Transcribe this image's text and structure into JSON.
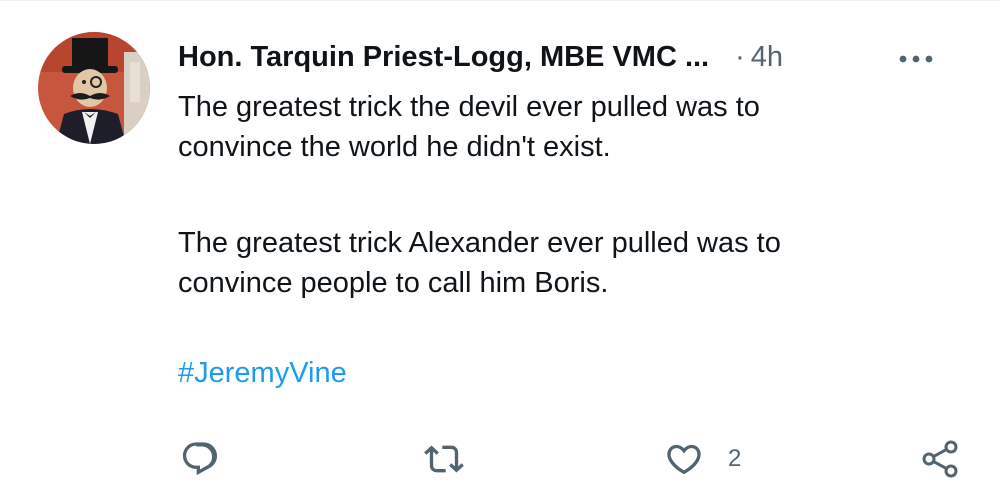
{
  "tweet": {
    "author_name": "Hon. Tarquin Priest-Logg, MBE VMC ...",
    "separator": "·",
    "timestamp": "4h",
    "text_lines": [
      "The greatest trick the devil ever pulled was to",
      "convince the world he didn't exist.",
      "The greatest trick Alexander ever pulled was to",
      "convince people to call him Boris."
    ],
    "hashtag": "#JeremyVine",
    "link_color": "#1d9bf0",
    "text_color": "#0f1419",
    "muted_color": "#536471"
  },
  "actions": {
    "reply": {
      "icon": "reply-icon",
      "count": ""
    },
    "retweet": {
      "icon": "retweet-icon",
      "count": ""
    },
    "like": {
      "icon": "heart-icon",
      "count": "2"
    },
    "share": {
      "icon": "share-icon"
    }
  },
  "header": {
    "more_icon": "more-options-icon"
  }
}
